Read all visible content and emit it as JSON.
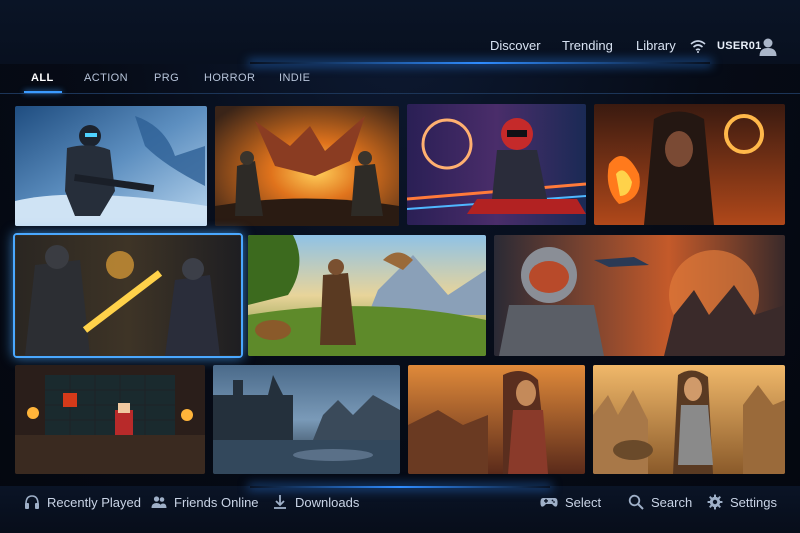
{
  "header": {
    "nav": [
      "Discover",
      "Trending",
      "Library"
    ],
    "username": "USER01"
  },
  "tabs": [
    {
      "label": "ALL",
      "active": true
    },
    {
      "label": "ACTION",
      "active": false
    },
    {
      "label": "PRG",
      "active": false
    },
    {
      "label": "HORROR",
      "active": false
    },
    {
      "label": "INDIE",
      "active": false
    }
  ],
  "grid": {
    "tiles": [
      {
        "name": "armored-soldier-snow",
        "selected": false
      },
      {
        "name": "dragon-battle",
        "selected": false
      },
      {
        "name": "cyber-rider",
        "selected": false
      },
      {
        "name": "fire-mage",
        "selected": false
      },
      {
        "name": "knight-sword-duel",
        "selected": true
      },
      {
        "name": "explorer-valley",
        "selected": false
      },
      {
        "name": "astronaut-planet",
        "selected": false
      },
      {
        "name": "pixel-dungeon",
        "selected": false
      },
      {
        "name": "stormy-castle",
        "selected": false
      },
      {
        "name": "desert-warrior",
        "selected": false
      },
      {
        "name": "warrior-woman-ruins",
        "selected": false
      }
    ]
  },
  "footer": {
    "left": [
      {
        "label": "Recently Played",
        "icon": "headphones-icon"
      },
      {
        "label": "Friends Online",
        "icon": "friends-icon"
      },
      {
        "label": "Downloads",
        "icon": "download-icon"
      }
    ],
    "right": [
      {
        "label": "Select",
        "icon": "gamepad-icon"
      },
      {
        "label": "Search",
        "icon": "search-icon"
      },
      {
        "label": "Settings",
        "icon": "gear-icon"
      }
    ]
  },
  "colors": {
    "accent": "#3b9bff",
    "background": "#060b16"
  }
}
